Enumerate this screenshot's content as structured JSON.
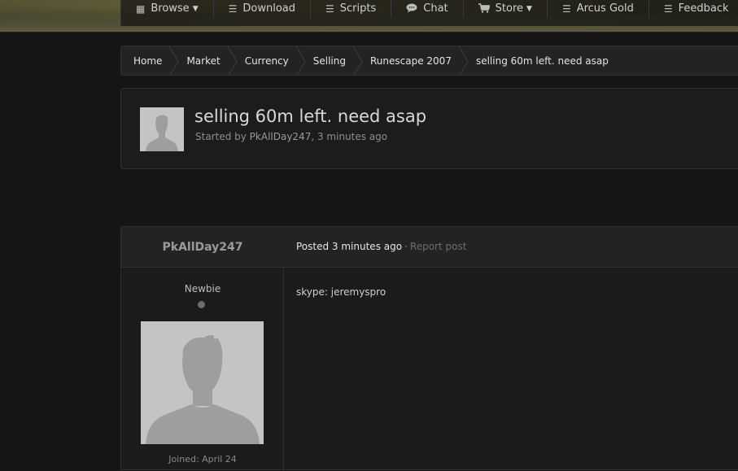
{
  "nav": {
    "items": [
      {
        "label": "Browse",
        "icon": "grid-icon",
        "dropdown": true
      },
      {
        "label": "Download",
        "icon": "list-icon",
        "dropdown": false
      },
      {
        "label": "Scripts",
        "icon": "list-icon",
        "dropdown": false
      },
      {
        "label": "Chat",
        "icon": "chat-icon",
        "dropdown": false
      },
      {
        "label": "Store",
        "icon": "cart-icon",
        "dropdown": true
      },
      {
        "label": "Arcus Gold",
        "icon": "list-icon",
        "dropdown": false
      },
      {
        "label": "Feedback",
        "icon": "list-icon",
        "dropdown": false
      }
    ]
  },
  "breadcrumb": [
    "Home",
    "Market",
    "Currency",
    "Selling",
    "Runescape 2007",
    "selling 60m left. need asap"
  ],
  "topic": {
    "title": "selling 60m left. need asap",
    "started_by_prefix": "Started by ",
    "author": "PkAllDay247",
    "time_suffix": ", 3 minutes ago"
  },
  "post": {
    "author": "PkAllDay247",
    "posted_label": "Posted 3 minutes ago",
    "separator": "·",
    "report_label": "Report post",
    "rank": "Newbie",
    "joined": "Joined: April 24",
    "body": "skype: jeremyspro"
  },
  "colors": {
    "background": "#151515",
    "panel": "#1c1c1c",
    "avatar_placeholder": "#c4c4c4"
  }
}
